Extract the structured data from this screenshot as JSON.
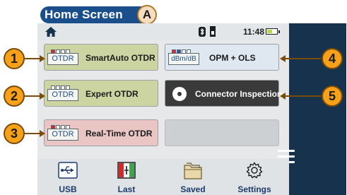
{
  "header": {
    "title": "Home Screen",
    "badge": "A"
  },
  "statusbar": {
    "time": "11:48"
  },
  "tiles": [
    {
      "icon_text": "OTDR",
      "label": "SmartAuto OTDR",
      "callout": "1"
    },
    {
      "icon_text": "OTDR",
      "label": "Expert OTDR",
      "callout": "2"
    },
    {
      "icon_text": "OTDR",
      "label": "Real-Time OTDR",
      "callout": "3"
    },
    {
      "icon_text": "dBm/dB",
      "label": "OPM + OLS",
      "callout": "4"
    },
    {
      "icon_text": "",
      "label": "Connector Inspection",
      "callout": "5"
    }
  ],
  "toolbar": [
    {
      "label": "USB",
      "icon": "usb-icon"
    },
    {
      "label": "Last",
      "icon": "last-result-icon"
    },
    {
      "label": "Saved",
      "icon": "folder-icon"
    },
    {
      "label": "Settings",
      "icon": "gear-icon"
    }
  ],
  "colors": {
    "title_pill": "#1a4f8c",
    "side_panel": "#17324d",
    "callout": "#f7a11a",
    "otdr_tile": "#ccd4a2",
    "realtime_tile": "#e9c6c4",
    "opm_tile": "#dfe7f1",
    "inspection_tile": "#3a3a3a"
  }
}
